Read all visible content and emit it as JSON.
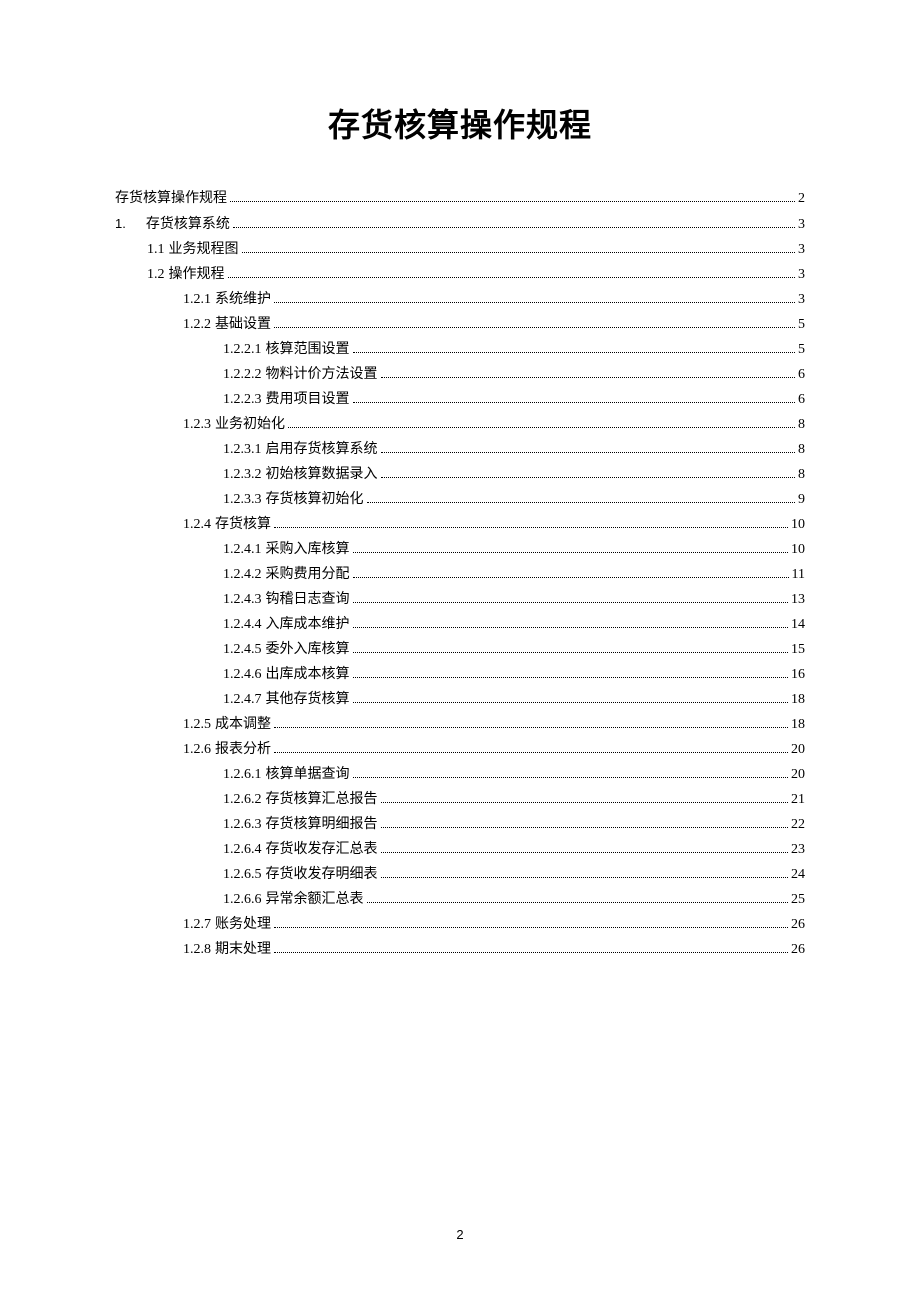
{
  "title": "存货核算操作规程",
  "page_number": "2",
  "toc": [
    {
      "level": 0,
      "num": "",
      "text": "存货核算操作规程",
      "page": "2"
    },
    {
      "level": 1,
      "num": "1.",
      "text": "存货核算系统",
      "page": "3",
      "numbered": true
    },
    {
      "level": 2,
      "num": "1.1",
      "text": "业务规程图",
      "page": "3"
    },
    {
      "level": 2,
      "num": "1.2",
      "text": "操作规程",
      "page": "3"
    },
    {
      "level": 3,
      "num": "1.2.1",
      "text": "系统维护",
      "page": "3"
    },
    {
      "level": 3,
      "num": "1.2.2",
      "text": "基础设置",
      "page": "5"
    },
    {
      "level": 4,
      "num": "1.2.2.1",
      "text": "核算范围设置",
      "page": "5"
    },
    {
      "level": 4,
      "num": "1.2.2.2",
      "text": "物料计价方法设置",
      "page": "6"
    },
    {
      "level": 4,
      "num": "1.2.2.3",
      "text": "费用项目设置",
      "page": "6"
    },
    {
      "level": 3,
      "num": "1.2.3",
      "text": "业务初始化",
      "page": "8"
    },
    {
      "level": 4,
      "num": "1.2.3.1",
      "text": "启用存货核算系统",
      "page": "8"
    },
    {
      "level": 4,
      "num": "1.2.3.2",
      "text": "初始核算数据录入",
      "page": "8"
    },
    {
      "level": 4,
      "num": "1.2.3.3",
      "text": "存货核算初始化",
      "page": "9"
    },
    {
      "level": 3,
      "num": "1.2.4",
      "text": "存货核算",
      "page": "10"
    },
    {
      "level": 4,
      "num": "1.2.4.1",
      "text": "采购入库核算",
      "page": "10"
    },
    {
      "level": 4,
      "num": "1.2.4.2",
      "text": "采购费用分配",
      "page": "11"
    },
    {
      "level": 4,
      "num": "1.2.4.3",
      "text": "钩稽日志查询",
      "page": "13"
    },
    {
      "level": 4,
      "num": "1.2.4.4",
      "text": "入库成本维护",
      "page": "14"
    },
    {
      "level": 4,
      "num": "1.2.4.5",
      "text": "委外入库核算",
      "page": "15"
    },
    {
      "level": 4,
      "num": "1.2.4.6",
      "text": "出库成本核算",
      "page": "16"
    },
    {
      "level": 4,
      "num": "1.2.4.7",
      "text": "其他存货核算",
      "page": "18"
    },
    {
      "level": 3,
      "num": "1.2.5",
      "text": "成本调整",
      "page": "18"
    },
    {
      "level": 3,
      "num": "1.2.6",
      "text": "报表分析",
      "page": "20"
    },
    {
      "level": 4,
      "num": "1.2.6.1",
      "text": "核算单据查询",
      "page": "20"
    },
    {
      "level": 4,
      "num": "1.2.6.2",
      "text": "存货核算汇总报告",
      "page": "21"
    },
    {
      "level": 4,
      "num": "1.2.6.3",
      "text": "存货核算明细报告",
      "page": "22"
    },
    {
      "level": 4,
      "num": "1.2.6.4",
      "text": "存货收发存汇总表",
      "page": "23"
    },
    {
      "level": 4,
      "num": "1.2.6.5",
      "text": "存货收发存明细表",
      "page": "24"
    },
    {
      "level": 4,
      "num": "1.2.6.6",
      "text": "异常余额汇总表",
      "page": "25"
    },
    {
      "level": 3,
      "num": "1.2.7",
      "text": "账务处理",
      "page": "26"
    },
    {
      "level": 3,
      "num": "1.2.8",
      "text": "期末处理",
      "page": "26"
    }
  ]
}
